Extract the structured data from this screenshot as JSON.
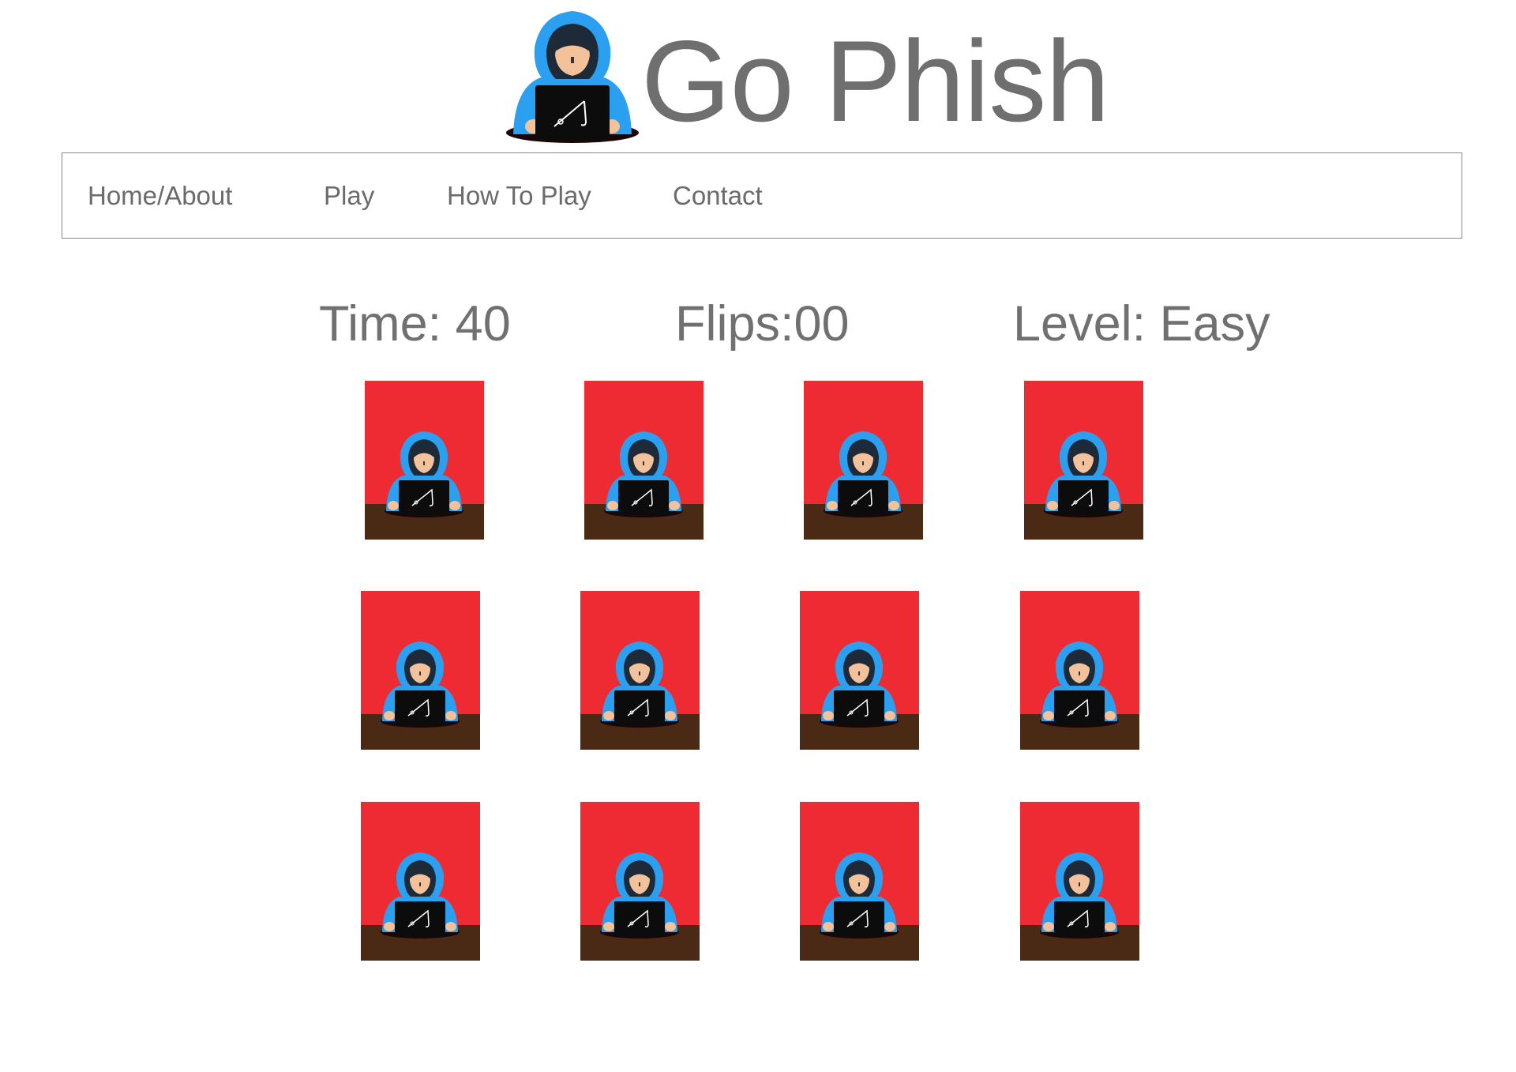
{
  "header": {
    "title": "Go Phish",
    "logo_icon": "hooded-hacker-laptop-icon"
  },
  "nav": {
    "items": [
      {
        "label": "Home/About"
      },
      {
        "label": "Play"
      },
      {
        "label": "How To Play"
      },
      {
        "label": "Contact"
      }
    ]
  },
  "game": {
    "time": "Time: 40",
    "flips": "Flips:00",
    "level": "Level: Easy",
    "card_count": 12,
    "card_back_icon": "hooded-hacker-laptop-icon"
  },
  "colors": {
    "card_background": "#ee2a32",
    "desk": "#4a2a14",
    "hood": "#2b9ff0",
    "text": "#707070"
  }
}
